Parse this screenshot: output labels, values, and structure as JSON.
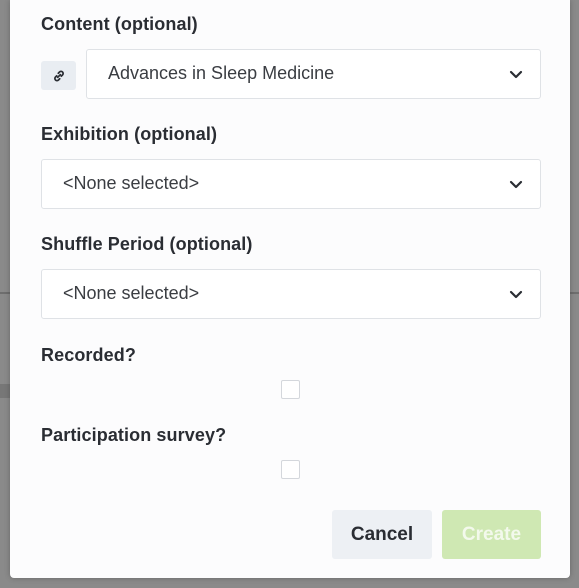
{
  "form": {
    "content": {
      "label": "Content (optional)",
      "value": "Advances in Sleep Medicine",
      "link_icon": "link-icon"
    },
    "exhibition": {
      "label": "Exhibition (optional)",
      "value": "<None selected>"
    },
    "shuffle_period": {
      "label": "Shuffle Period (optional)",
      "value": "<None selected>"
    },
    "recorded": {
      "label": "Recorded?",
      "checked": false
    },
    "participation_survey": {
      "label": "Participation survey?",
      "checked": false
    }
  },
  "actions": {
    "cancel_label": "Cancel",
    "create_label": "Create"
  },
  "colors": {
    "create_button_disabled": "#cfe8b3",
    "cancel_button": "#edf0f4"
  }
}
